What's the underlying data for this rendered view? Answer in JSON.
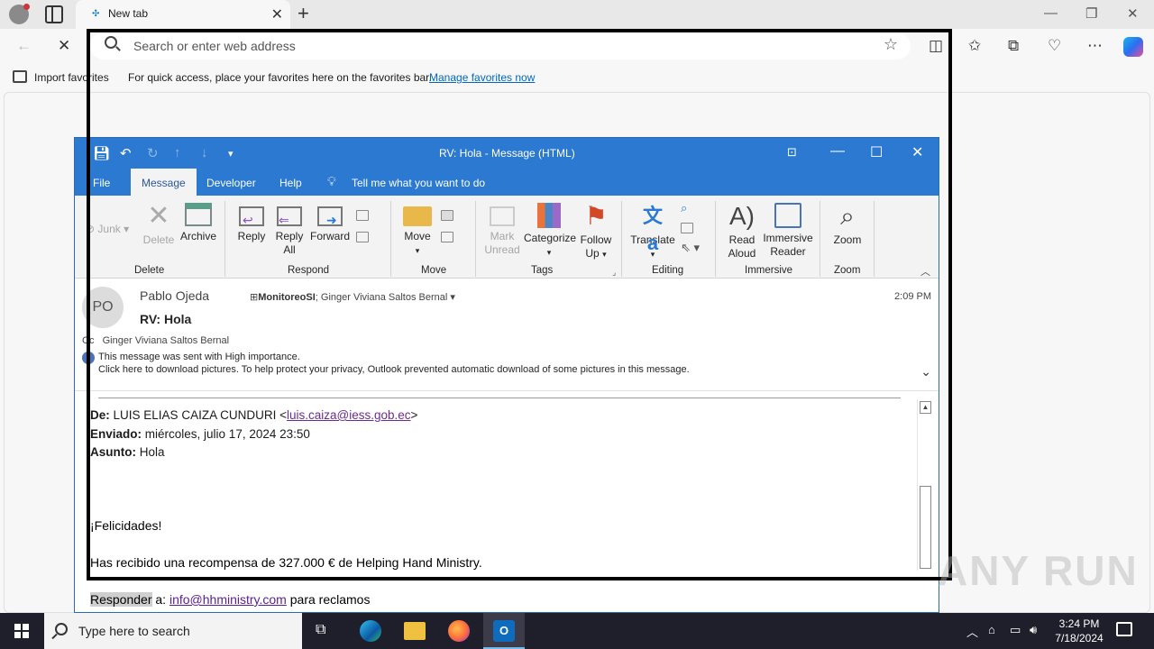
{
  "browser": {
    "tab_title": "New tab",
    "address_placeholder": "Search or enter web address",
    "favorites": {
      "import_label": "Import favorites",
      "hint": "For quick access, place your favorites here on the favorites bar.",
      "manage_link": "Manage favorites now"
    }
  },
  "outlook": {
    "window_title": "RV: Hola  -  Message (HTML)",
    "menu_tabs": [
      "File",
      "Message",
      "Developer",
      "Help"
    ],
    "tell_me": "Tell me what you want to do",
    "ribbon": {
      "junk": "Junk",
      "delete": "Delete",
      "archive": "Archive",
      "group_delete": "Delete",
      "reply": "Reply",
      "reply_all_1": "Reply",
      "reply_all_2": "All",
      "forward": "Forward",
      "group_respond": "Respond",
      "move": "Move",
      "group_move": "Move",
      "mark_unread_1": "Mark",
      "mark_unread_2": "Unread",
      "categorize": "Categorize",
      "follow_up_1": "Follow",
      "follow_up_2": "Up",
      "group_tags": "Tags",
      "translate": "Translate",
      "group_editing": "Editing",
      "read_aloud_1": "Read",
      "read_aloud_2": "Aloud",
      "immersive_1": "Immersive",
      "immersive_2": "Reader",
      "group_immersive": "Immersive",
      "zoom": "Zoom",
      "group_zoom": "Zoom"
    },
    "message": {
      "avatar_initials": "PO",
      "sender": "Pablo Ojeda",
      "recipient_group": "MonitoreoSI",
      "recipient_other": "; Ginger Viviana Saltos Bernal",
      "time": "2:09 PM",
      "subject": "RV: Hola",
      "cc_label": "Cc",
      "cc": "Ginger Viviana Saltos Bernal",
      "importance": "This message was sent with High importance.",
      "pictures_notice": "Click here to download pictures. To help protect your privacy, Outlook prevented automatic download of some pictures in this message."
    },
    "body": {
      "from_label": "De:",
      "from_name": "LUIS ELIAS CAIZA CUNDURI <",
      "from_email": "luis.caiza@iess.gob.ec",
      "from_close": ">",
      "sent_label": "Enviado:",
      "sent_value": "miércoles, julio 17, 2024 23:50",
      "subject_label": "Asunto:",
      "subject_value": "Hola",
      "line1": "¡Felicidades!",
      "line2": "Has recibido una recompensa de 327.000 € de Helping Hand Ministry.",
      "reply_word": "Responder",
      "reply_to": " a: ",
      "reply_email": "info@hhministry.com",
      "reply_tail": " para reclamos"
    }
  },
  "taskbar": {
    "search_placeholder": "Type here to search",
    "time": "3:24 PM",
    "date": "7/18/2024"
  },
  "watermark": "ANY RUN"
}
